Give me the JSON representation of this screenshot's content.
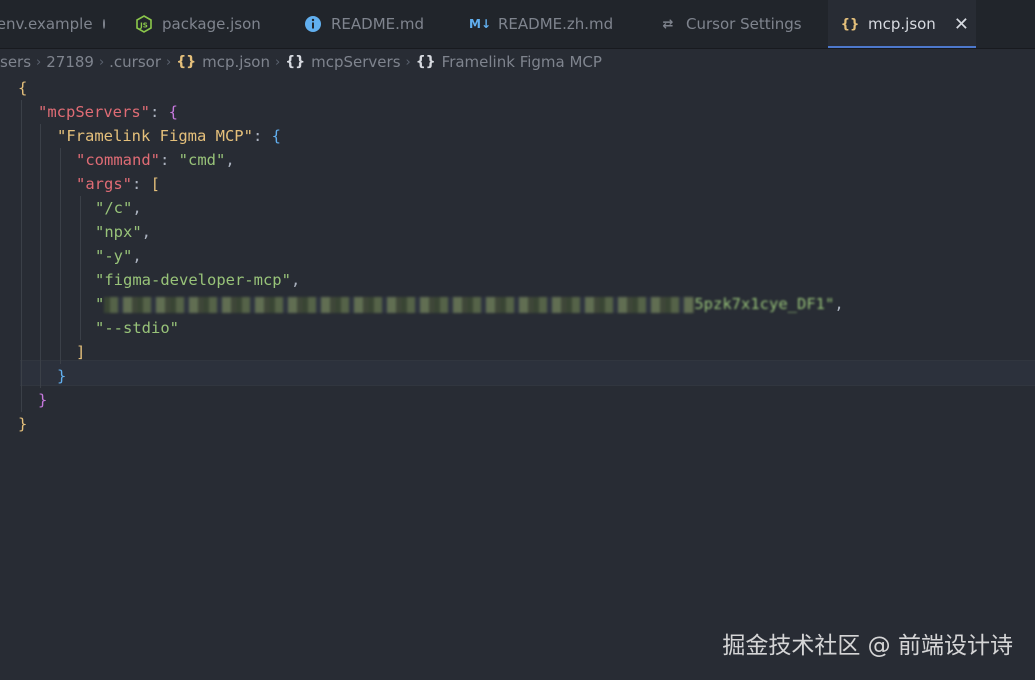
{
  "tabs": [
    {
      "label": ".env.example",
      "icon": "",
      "state": "modified"
    },
    {
      "label": "package.json",
      "icon": "nodejs-icon"
    },
    {
      "label": "README.md",
      "icon": "info-icon"
    },
    {
      "label": "README.zh.md",
      "icon": "markdown-icon"
    },
    {
      "label": "Cursor Settings",
      "icon": "settings-sliders-icon"
    },
    {
      "label": "mcp.json",
      "icon": "json-braces-icon",
      "active": true
    }
  ],
  "breadcrumb": [
    {
      "label": "sers"
    },
    {
      "label": "27189"
    },
    {
      "label": ".cursor"
    },
    {
      "label": "mcp.json",
      "icon": "{}"
    },
    {
      "label": "mcpServers",
      "icon": "{}"
    },
    {
      "label": "Framelink Figma MCP",
      "icon": "{}"
    }
  ],
  "code": {
    "line1": "{",
    "key_mcpServers": "\"mcpServers\"",
    "key_framelink": "\"Framelink Figma MCP\"",
    "key_command": "\"command\"",
    "val_command": "\"cmd\"",
    "key_args": "\"args\"",
    "args": [
      "\"/c\"",
      "\"npx\"",
      "\"-y\"",
      "\"figma-developer-mcp\""
    ],
    "arg_blurred_tail": "5pzk7x1cye_DF1\"",
    "arg_stdio": "\"--stdio\""
  },
  "watermark": "掘金技术社区 @ 前端设计诗",
  "colors": {
    "background": "#282c34",
    "tabbar": "#21252b",
    "key": "#e06c75",
    "string": "#98c379",
    "bracket_level1": "#e5c07b",
    "bracket_level2": "#c678dd",
    "bracket_level3": "#61afef",
    "accent": "#4d78cc"
  }
}
